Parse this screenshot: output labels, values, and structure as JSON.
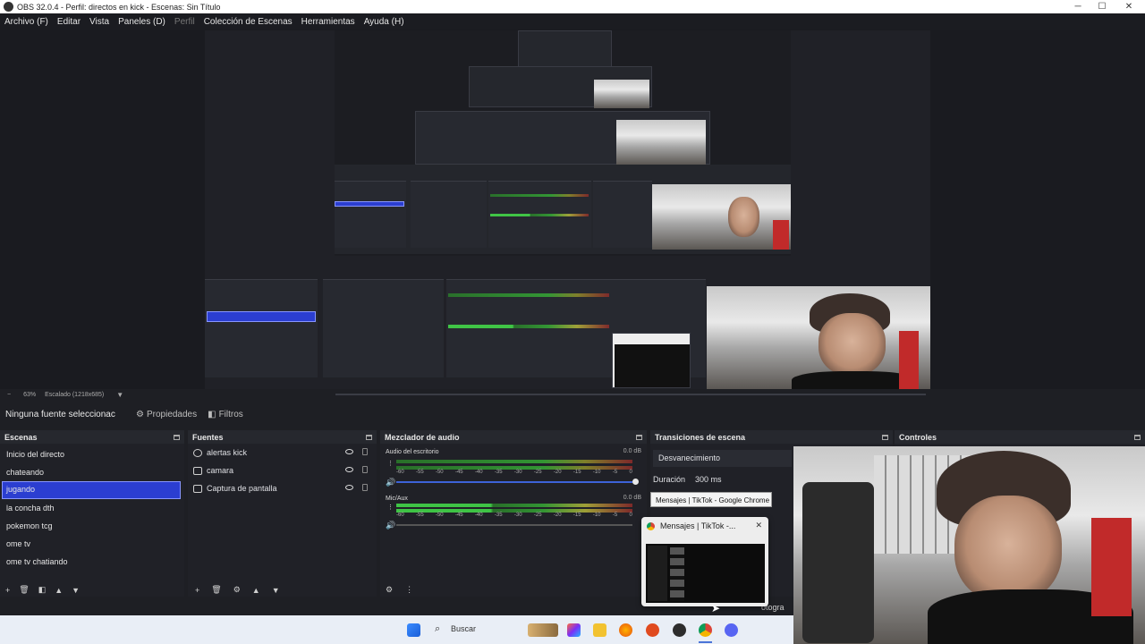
{
  "window": {
    "title": "OBS 32.0.4 - Perfil: directos en kick - Escenas: Sin Título",
    "minimize": "─",
    "maximize": "☐",
    "close": "✕"
  },
  "menu": [
    "Archivo (F)",
    "Editar",
    "Vista",
    "Paneles (D)",
    "Perfil",
    "Colección de Escenas",
    "Herramientas",
    "Ayuda (H)"
  ],
  "scale": {
    "zoom": "63%",
    "label": "Escalado (1218x685)"
  },
  "source_toolbar": {
    "no_source": "Ninguna fuente seleccionac",
    "properties": "Propiedades",
    "filters": "Filtros"
  },
  "scenes": {
    "title": "Escenas",
    "items": [
      "Inicio del directo",
      "chateando",
      "jugando",
      "la concha dth",
      "pokemon tcg",
      "ome tv",
      "ome tv chatiando"
    ],
    "selected": 2
  },
  "sources": {
    "title": "Fuentes",
    "items": [
      {
        "name": "alertas kick",
        "icon": "browser-icon"
      },
      {
        "name": "camara",
        "icon": "camera-icon"
      },
      {
        "name": "Captura de pantalla",
        "icon": "display-icon"
      }
    ]
  },
  "mixer": {
    "title": "Mezclador de audio",
    "channels": [
      {
        "name": "Audio del escritorio",
        "db": "0.0 dB"
      },
      {
        "name": "Mic/Aux",
        "db": "0.0 dB"
      }
    ],
    "ticks": [
      "-60",
      "-55",
      "-50",
      "-45",
      "-40",
      "-35",
      "-30",
      "-25",
      "-20",
      "-15",
      "-10",
      "-5",
      "0"
    ]
  },
  "transitions": {
    "title": "Transiciones de escena",
    "selected": "Desvanecimiento",
    "duration_label": "Duración",
    "duration_value": "300 ms"
  },
  "controls": {
    "title": "Controles",
    "partial": "otogra"
  },
  "tooltip": "Mensajes | TikTok - Google Chrome",
  "popup": {
    "title": "Mensajes | TikTok -...",
    "close": "✕"
  },
  "taskbar": {
    "search": "Buscar"
  },
  "colors": {
    "accent": "#2b3ed1",
    "panel": "#202127",
    "header": "#26282e"
  }
}
